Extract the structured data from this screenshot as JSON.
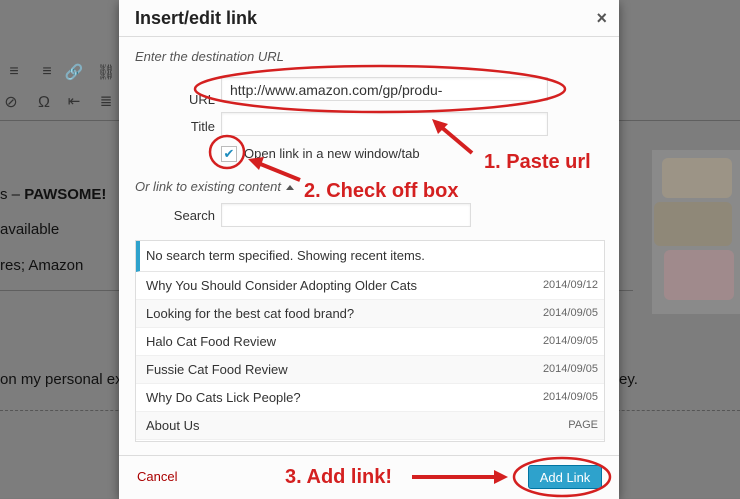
{
  "editor": {
    "toolbar_row1": [
      "≡",
      "≡"
    ],
    "toolbar_row1_right": [
      "🔗",
      "⛓"
    ],
    "toolbar_row2": [
      "⊘",
      "Ω"
    ],
    "toolbar_row2_right": [
      "⇤",
      "≣"
    ],
    "line1_prefix": "s – ",
    "line1_bold": "PAWSOME!",
    "line2": "available",
    "line3": "res; Amazon",
    "line4_left": "on my personal ex",
    "line4_right": "ey."
  },
  "dialog": {
    "title": "Insert/edit link",
    "close_glyph": "×",
    "dest_label": "Enter the destination URL",
    "url_label": "URL",
    "url_value": "http://www.amazon.com/gp/produ-",
    "title_label": "Title",
    "title_value": "",
    "checkbox_checked": "✔",
    "checkbox_label": "Open link in a new window/tab",
    "existing_label": "Or link to existing content",
    "search_label": "Search",
    "search_value": "",
    "results_notice": "No search term specified. Showing recent items.",
    "results": [
      {
        "title": "Why You Should Consider Adopting Older Cats",
        "date": "2014/09/12"
      },
      {
        "title": "Looking for the best cat food brand?",
        "date": "2014/09/05"
      },
      {
        "title": "Halo Cat Food Review",
        "date": "2014/09/05"
      },
      {
        "title": "Fussie Cat Food Review",
        "date": "2014/09/05"
      },
      {
        "title": "Why Do Cats Lick People?",
        "date": "2014/09/05"
      },
      {
        "title": "About Us",
        "date": "PAGE"
      }
    ],
    "cancel_label": "Cancel",
    "add_link_label": "Add Link"
  },
  "annotations": {
    "step1": "1. Paste url",
    "step2": "2. Check off box",
    "step3": "3. Add link!",
    "color": "#d42020"
  }
}
